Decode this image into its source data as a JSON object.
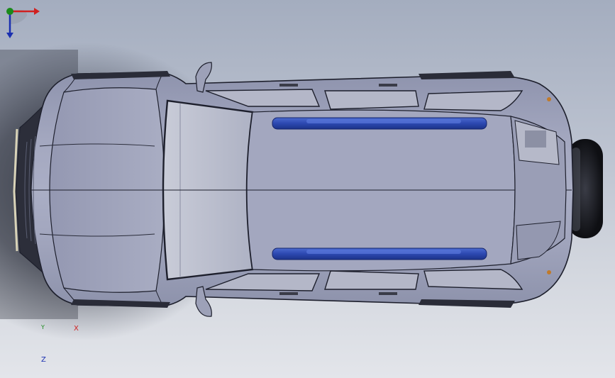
{
  "viewport": {
    "background_top": "#a4adbf",
    "background_bottom": "#e3e5ea"
  },
  "model": {
    "body_color": "#a1a5bd",
    "edge_color": "#1d1f2c",
    "glass_color": "#b9bccd",
    "roof_rail_color": "#2f4fb8",
    "spare_tire_color": "#16171c"
  },
  "triad": {
    "x_label": "X",
    "y_label": "Y",
    "z_label": "Z",
    "x_color": "#d02020",
    "y_color": "#1a8a1a",
    "z_color": "#1a2fb0"
  }
}
